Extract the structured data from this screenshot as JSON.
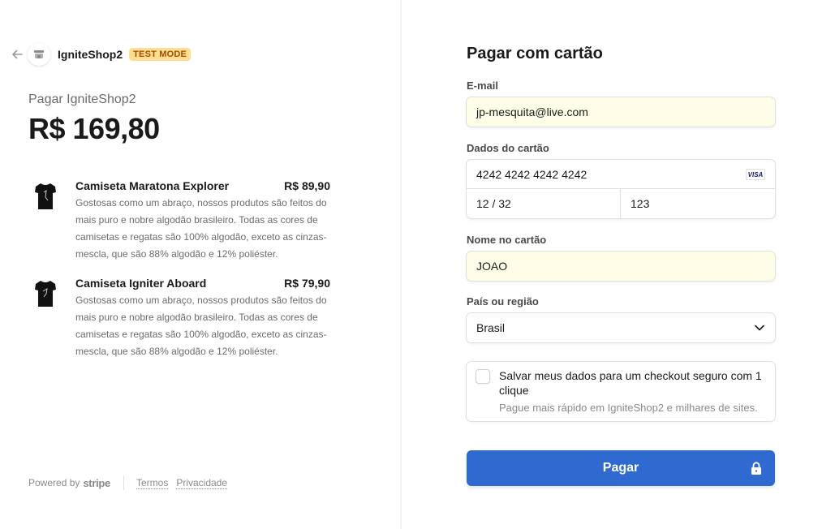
{
  "shop": {
    "name": "IgniteShop2",
    "badge": "TEST MODE"
  },
  "summary": {
    "pay_label": "Pagar IgniteShop2",
    "total": "R$ 169,80"
  },
  "items": [
    {
      "name": "Camiseta Maratona Explorer",
      "price": "R$ 89,90",
      "description": "Gostosas como um abraço, nossos produtos são feitos do mais puro e nobre algodão brasileiro. Todas as cores de camisetas e regatas são 100% algodão, exceto as cinzas-mescla, que são 88% algodão e 12% poliéster."
    },
    {
      "name": "Camiseta Igniter Aboard",
      "price": "R$ 79,90",
      "description": "Gostosas como um abraço, nossos produtos são feitos do mais puro e nobre algodão brasileiro. Todas as cores de camisetas e regatas são 100% algodão, exceto as cinzas-mescla, que são 88% algodão e 12% poliéster."
    }
  ],
  "footer": {
    "powered_by": "Powered by",
    "stripe": "stripe",
    "terms": "Termos",
    "privacy": "Privacidade"
  },
  "form": {
    "title": "Pagar com cartão",
    "email_label": "E-mail",
    "email_value": "jp-mesquita@live.com",
    "card_label": "Dados do cartão",
    "card_number": "4242 4242 4242 4242",
    "card_brand": "VISA",
    "card_expiry": "12 / 32",
    "card_cvc": "123",
    "name_label": "Nome no cartão",
    "name_value": "JOAO",
    "country_label": "País ou região",
    "country_value": "Brasil",
    "save_title": "Salvar meus dados para um checkout seguro com 1 clique",
    "save_subtitle": "Pague mais rápido em IgniteShop2 e milhares de sites.",
    "save_checked": false,
    "pay_button": "Pagar"
  },
  "colors": {
    "pay_button": "#2f6ad0",
    "test_badge_bg": "#ffde92",
    "test_badge_text": "#a04e00",
    "autofill_bg": "#fefde8"
  },
  "icons": [
    "back-arrow-icon",
    "store-icon",
    "tshirt-icon",
    "visa-card-icon",
    "chevron-down-icon",
    "lock-icon"
  ]
}
